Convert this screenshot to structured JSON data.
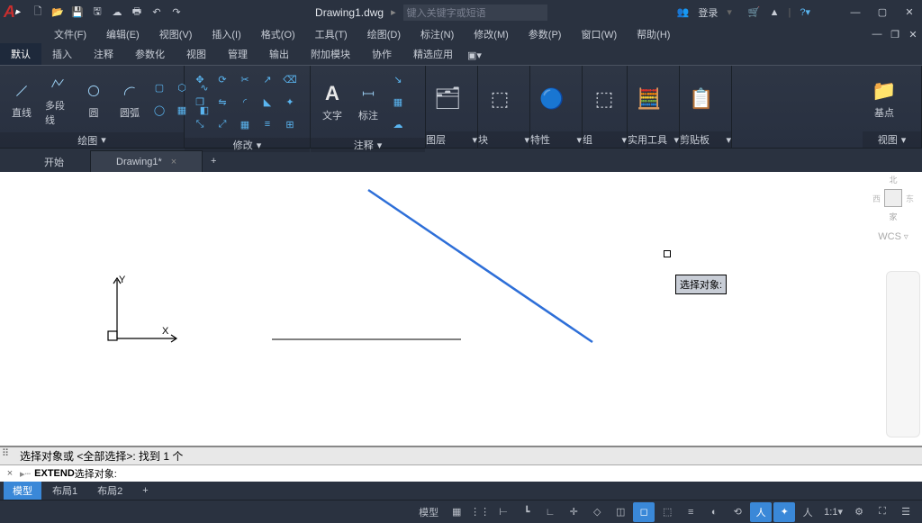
{
  "title": {
    "filename": "Drawing1.dwg",
    "search_placeholder": "键入关键字或短语",
    "login": "登录"
  },
  "menu": {
    "file": "文件(F)",
    "edit": "编辑(E)",
    "view": "视图(V)",
    "insert": "插入(I)",
    "format": "格式(O)",
    "tools": "工具(T)",
    "draw": "绘图(D)",
    "annotate": "标注(N)",
    "modify": "修改(M)",
    "params": "参数(P)",
    "window": "窗口(W)",
    "help": "帮助(H)"
  },
  "ribbon_tabs": {
    "default": "默认",
    "insert": "插入",
    "annotate": "注释",
    "param": "参数化",
    "view": "视图",
    "manage": "管理",
    "output": "输出",
    "addon": "附加模块",
    "collab": "协作",
    "featured": "精选应用"
  },
  "panels": {
    "draw": {
      "title": "绘图",
      "line": "直线",
      "polyline": "多段线",
      "circle": "圆",
      "arc": "圆弧"
    },
    "modify": {
      "title": "修改"
    },
    "annotate": {
      "title": "注释",
      "text": "文字",
      "dim": "标注"
    },
    "layers": {
      "title": "图层"
    },
    "block": {
      "title": "块"
    },
    "props": {
      "title": "特性"
    },
    "group": {
      "title": "组"
    },
    "util": {
      "title": "实用工具"
    },
    "clip": {
      "title": "剪贴板"
    },
    "view": {
      "title": "视图",
      "base": "基点"
    }
  },
  "doc_tabs": {
    "start": "开始",
    "drawing": "Drawing1*"
  },
  "side": {
    "top": "北",
    "wcs": "WCS",
    "home": "家"
  },
  "tooltip": "选择对象:",
  "ucs": {
    "x": "X",
    "y": "Y"
  },
  "cmd": {
    "history": "选择对象或 <全部选择>:   找到  1 个",
    "prompt_cmd": "EXTEND",
    "prompt_text": " 选择对象:"
  },
  "layout": {
    "model": "模型",
    "l1": "布局1",
    "l2": "布局2"
  },
  "status": {
    "model": "模型",
    "scale": "1:1"
  }
}
